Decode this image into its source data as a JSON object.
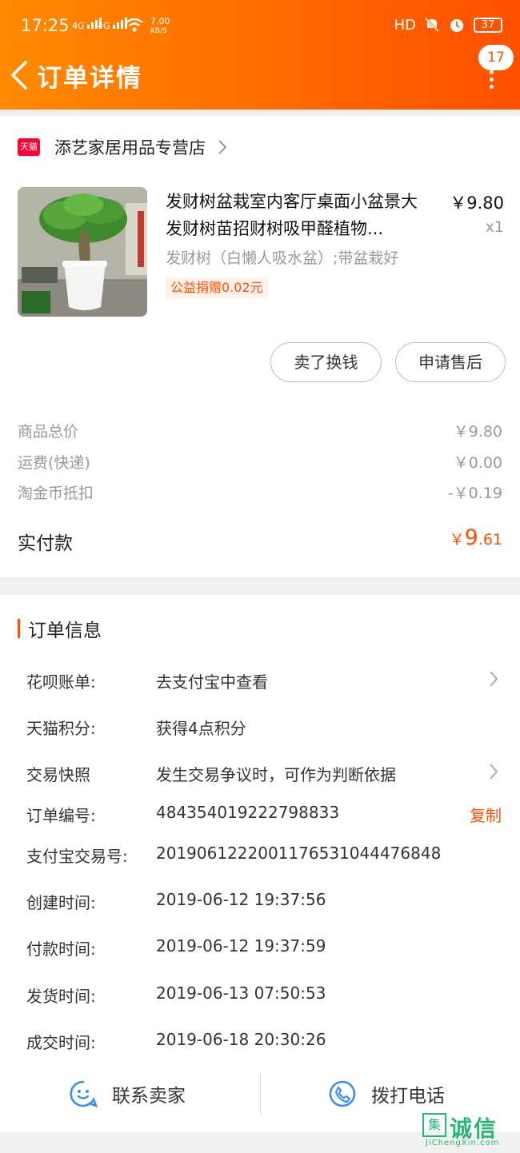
{
  "status_bar": {
    "time": "17:25",
    "network1": "4G",
    "network2": "4G",
    "speed": "7.00",
    "speed_unit": "KB/S",
    "hd": "HD",
    "battery": "37"
  },
  "header": {
    "title": "订单详情",
    "badge_count": "17"
  },
  "shop": {
    "badge": "天猫",
    "name": "添艺家居用品专营店"
  },
  "product": {
    "title": "发财树盆栽室内客厅桌面小盆景大发财树苗招财树吸甲醛植物...",
    "price": "￥9.80",
    "quantity": "x1",
    "spec": "发财树（白懒人吸水盆）;带盆栽好",
    "donation": "公益捐赠0.02元"
  },
  "buttons": {
    "sell": "卖了换钱",
    "after_sale": "申请售后"
  },
  "fees": [
    {
      "label": "商品总价",
      "value": "￥9.80"
    },
    {
      "label": "运费(快递)",
      "value": "￥0.00"
    },
    {
      "label": "淘金币抵扣",
      "value": "-￥0.19"
    }
  ],
  "paid": {
    "label": "实付款",
    "currency": "￥",
    "integer": "9",
    "decimal": ".61"
  },
  "order_info": {
    "title": "订单信息",
    "rows": [
      {
        "key": "花呗账单:",
        "value": "去支付宝中查看"
      },
      {
        "key": "天猫积分:",
        "value": "获得4点积分"
      },
      {
        "key": "交易快照",
        "value": "发生交易争议时，可作为判断依据"
      },
      {
        "key": "订单编号:",
        "value": "484354019222798833",
        "action": "复制"
      },
      {
        "key": "支付宝交易号:",
        "value": "2019061222001176531044476848"
      },
      {
        "key": "创建时间:",
        "value": "2019-06-12 19:37:56"
      },
      {
        "key": "付款时间:",
        "value": "2019-06-12 19:37:59"
      },
      {
        "key": "发货时间:",
        "value": "2019-06-13 07:50:53"
      },
      {
        "key": "成交时间:",
        "value": "2019-06-18 20:30:26"
      }
    ]
  },
  "actions": {
    "contact": "联系卖家",
    "call": "拨打电话"
  },
  "watermark": {
    "box": "集",
    "text": "诚信",
    "sub": "JiChengXin.com"
  },
  "colors": {
    "accent": "#ff5000",
    "header_start": "#ff8a00",
    "tmall_red": "#ff0036",
    "icon_blue": "#3d8ee8"
  }
}
